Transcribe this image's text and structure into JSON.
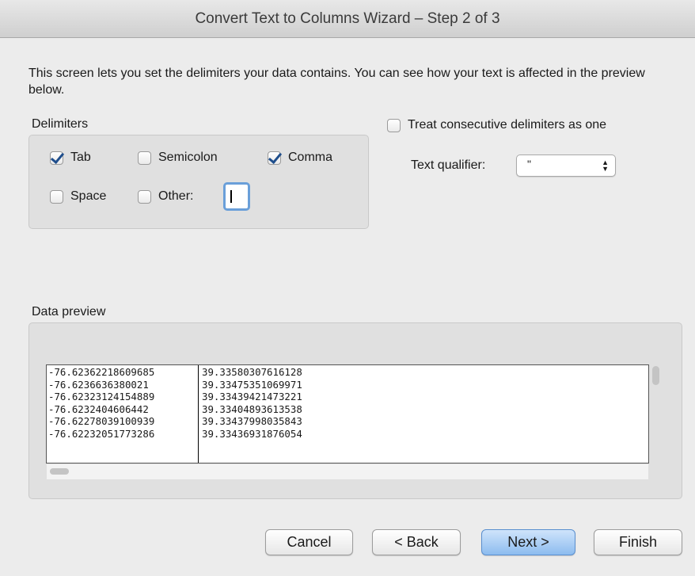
{
  "window": {
    "title": "Convert Text to Columns Wizard – Step 2 of 3"
  },
  "intro": "This screen lets you set the delimiters your data contains.  You can see how your text is affected in the preview below.",
  "delimiters": {
    "label": "Delimiters",
    "tab": {
      "label": "Tab",
      "checked": true
    },
    "semicolon": {
      "label": "Semicolon",
      "checked": false
    },
    "comma": {
      "label": "Comma",
      "checked": true
    },
    "space": {
      "label": "Space",
      "checked": false
    },
    "other": {
      "label": "Other:",
      "checked": false,
      "value": ""
    }
  },
  "options": {
    "consecutive": {
      "label": "Treat consecutive delimiters as one",
      "checked": false
    },
    "qualifier_label": "Text qualifier:",
    "qualifier_value": "\""
  },
  "preview": {
    "label": "Data preview",
    "rows": [
      [
        "-76.62362218609685",
        "39.33580307616128"
      ],
      [
        "-76.6236636380021",
        "39.33475351069971"
      ],
      [
        "-76.62323124154889",
        "39.33439421473221"
      ],
      [
        "-76.6232404606442",
        "39.33404893613538"
      ],
      [
        "-76.62278039100939",
        "39.33437998035843"
      ],
      [
        "-76.62232051773286",
        "39.33436931876054"
      ]
    ]
  },
  "buttons": {
    "cancel": "Cancel",
    "back": "< Back",
    "next": "Next >",
    "finish": "Finish"
  }
}
